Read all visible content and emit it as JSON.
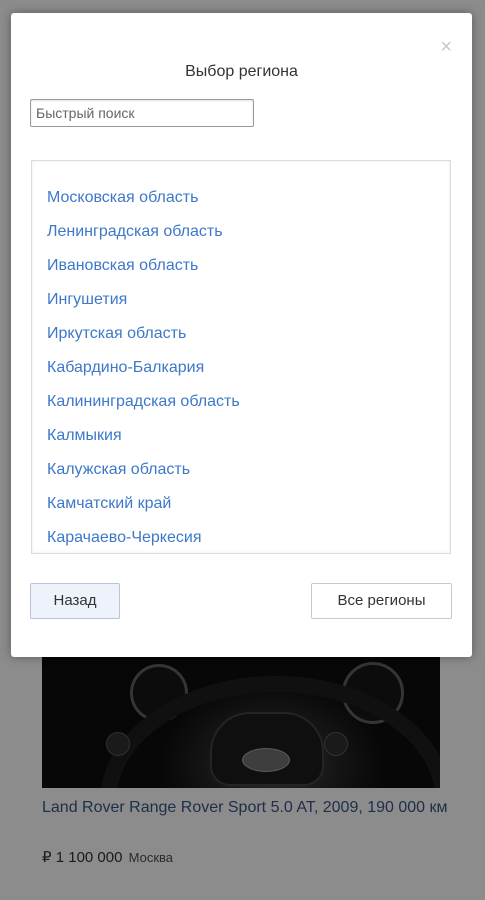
{
  "modal": {
    "title": "Выбор региона",
    "close_glyph": "×",
    "search_placeholder": "Быстрый поиск",
    "regions": [
      "Московская область",
      "Ленинградская область",
      "Ивановская область",
      "Ингушетия",
      "Иркутская область",
      "Кабардино-Балкария",
      "Калининградская область",
      "Калмыкия",
      "Калужская область",
      "Камчатский край",
      "Карачаево-Черкесия"
    ],
    "back_label": "Назад",
    "all_regions_label": "Все регионы"
  },
  "listing": {
    "title": "Land Rover Range Rover Sport 5.0 AT, 2009, 190 000 км",
    "price": "₽ 1 100 000",
    "city": "Москва"
  },
  "colors": {
    "link": "#3d78c9",
    "overlay": "rgba(0,0,0,0.42)"
  }
}
